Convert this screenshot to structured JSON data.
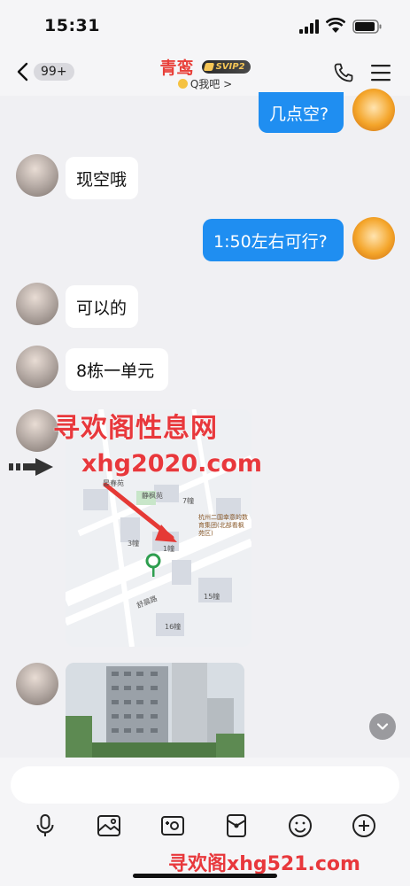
{
  "status_bar": {
    "time": "15:31"
  },
  "header": {
    "back_badge": "99+",
    "title": "青鸾",
    "vip_badge": "SVIP2",
    "subtitle": "Q我吧 >"
  },
  "messages": [
    {
      "side": "out",
      "text": "几点空?"
    },
    {
      "side": "in",
      "text": "现空哦"
    },
    {
      "side": "out",
      "text": "1:50左右可行?"
    },
    {
      "side": "in",
      "text": "可以的"
    },
    {
      "side": "in",
      "text": "8栋一单元"
    }
  ],
  "map": {
    "labels": [
      "静枫苑",
      "7幢",
      "3幢",
      "1幢",
      "15幢",
      "16幢",
      "晏春苑",
      "杭州二国幸意的数育集团(北部看枫苑区)",
      "舒晨路"
    ]
  },
  "watermarks": {
    "top_text": "寻欢阁性息网",
    "url": "xhg2020.com",
    "bottom": "寻欢阁xhg521.com"
  },
  "input": {
    "placeholder": ""
  },
  "colors": {
    "accent": "#1f8ef1",
    "title_red": "#e8403a",
    "watermark": "#e8383c"
  }
}
